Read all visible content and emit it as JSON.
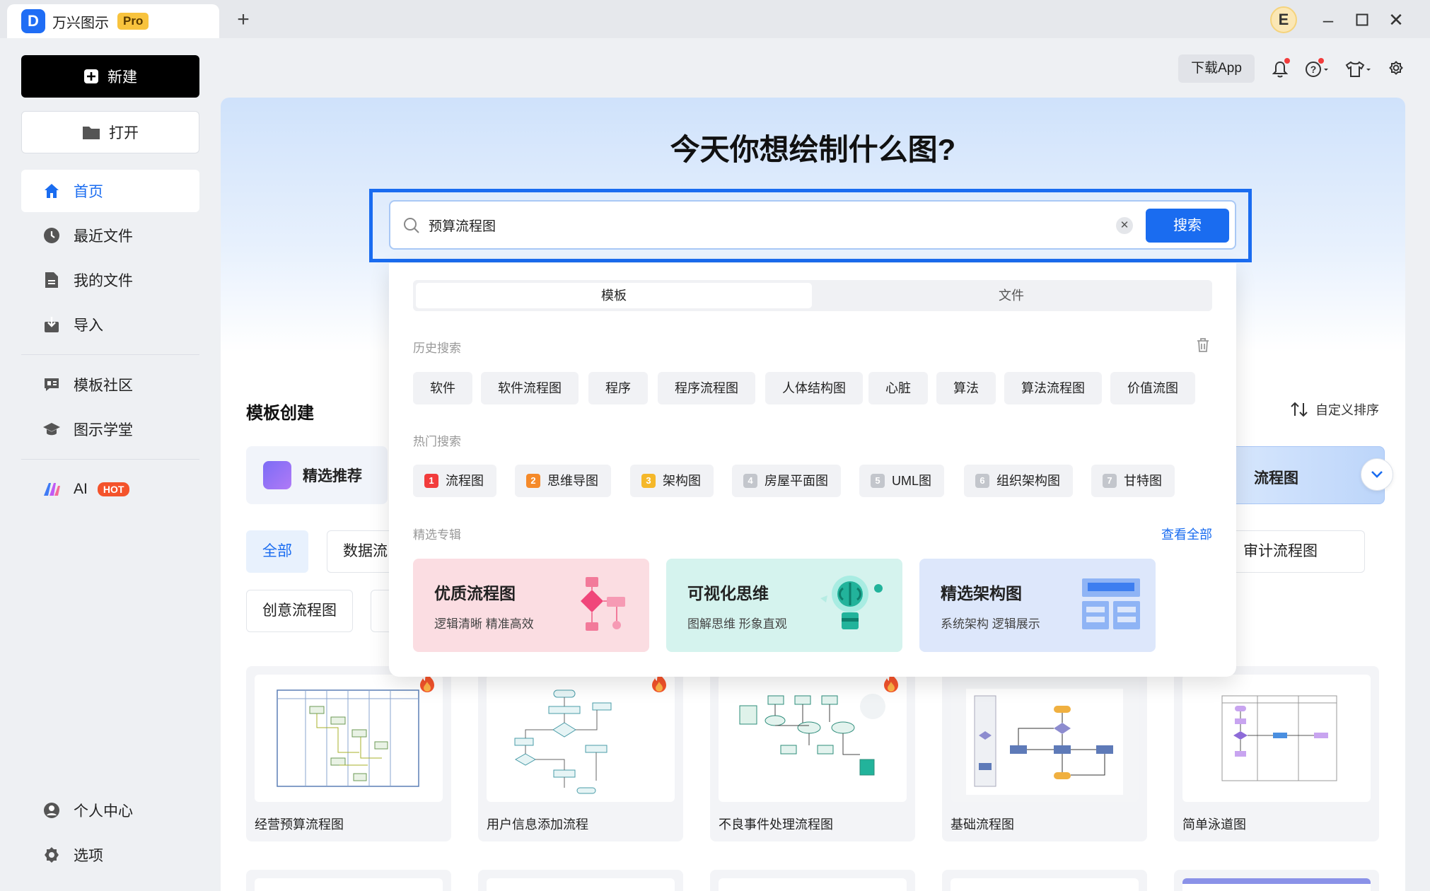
{
  "app": {
    "name": "万兴图示",
    "edition": "Pro",
    "avatar_letter": "E"
  },
  "sidebar": {
    "new_label": "新建",
    "open_label": "打开",
    "nav": [
      {
        "label": "首页",
        "icon": "home-icon"
      },
      {
        "label": "最近文件",
        "icon": "clock-icon"
      },
      {
        "label": "我的文件",
        "icon": "file-icon"
      },
      {
        "label": "导入",
        "icon": "import-icon"
      },
      {
        "label": "模板社区",
        "icon": "template-community-icon"
      },
      {
        "label": "图示学堂",
        "icon": "graduation-cap-icon"
      },
      {
        "label": "AI",
        "icon": "ai-icon",
        "badge": "HOT"
      }
    ],
    "bottom": [
      {
        "label": "个人中心",
        "icon": "user-icon"
      },
      {
        "label": "选项",
        "icon": "gear-icon"
      }
    ]
  },
  "toolbar": {
    "download_app": "下载App"
  },
  "hero": {
    "title": "今天你想绘制什么图?"
  },
  "search": {
    "value": "预算流程图",
    "button": "搜索"
  },
  "dropdown": {
    "tabs": [
      "模板",
      "文件"
    ],
    "history_label": "历史搜索",
    "history": [
      "软件",
      "软件流程图",
      "程序",
      "程序流程图",
      "人体结构图",
      "心脏",
      "算法",
      "算法流程图",
      "价值流图"
    ],
    "hot_label": "热门搜索",
    "hot": [
      {
        "rank": "1",
        "label": "流程图"
      },
      {
        "rank": "2",
        "label": "思维导图"
      },
      {
        "rank": "3",
        "label": "架构图"
      },
      {
        "rank": "4",
        "label": "房屋平面图"
      },
      {
        "rank": "5",
        "label": "UML图"
      },
      {
        "rank": "6",
        "label": "组织架构图"
      },
      {
        "rank": "7",
        "label": "甘特图"
      }
    ],
    "featured_label": "精选专辑",
    "view_all": "查看全部",
    "albums": [
      {
        "title": "优质流程图",
        "subtitle": "逻辑清晰 精准高效",
        "bg": "#fbdde2"
      },
      {
        "title": "可视化思维",
        "subtitle": "图解思维 形象直观",
        "bg": "#d5f3ee"
      },
      {
        "title": "精选架构图",
        "subtitle": "系统架构 逻辑展示",
        "bg": "#dde7fb"
      }
    ]
  },
  "section": {
    "title": "模板创建",
    "sort_label": "自定义排序",
    "featured": "精选推荐",
    "right_tab": "流程图"
  },
  "chips": {
    "all": "全部",
    "data": "数据流",
    "creative": "创意流程图",
    "audit": "审计流程图"
  },
  "templates": [
    {
      "name": "经营预算流程图",
      "hot": true
    },
    {
      "name": "用户信息添加流程",
      "hot": true
    },
    {
      "name": "不良事件处理流程图",
      "hot": true
    },
    {
      "name": "基础流程图",
      "hot": false
    },
    {
      "name": "简单泳道图",
      "hot": false
    }
  ],
  "colors": {
    "accent": "#1a6cf0",
    "hot": "#f4532b"
  }
}
